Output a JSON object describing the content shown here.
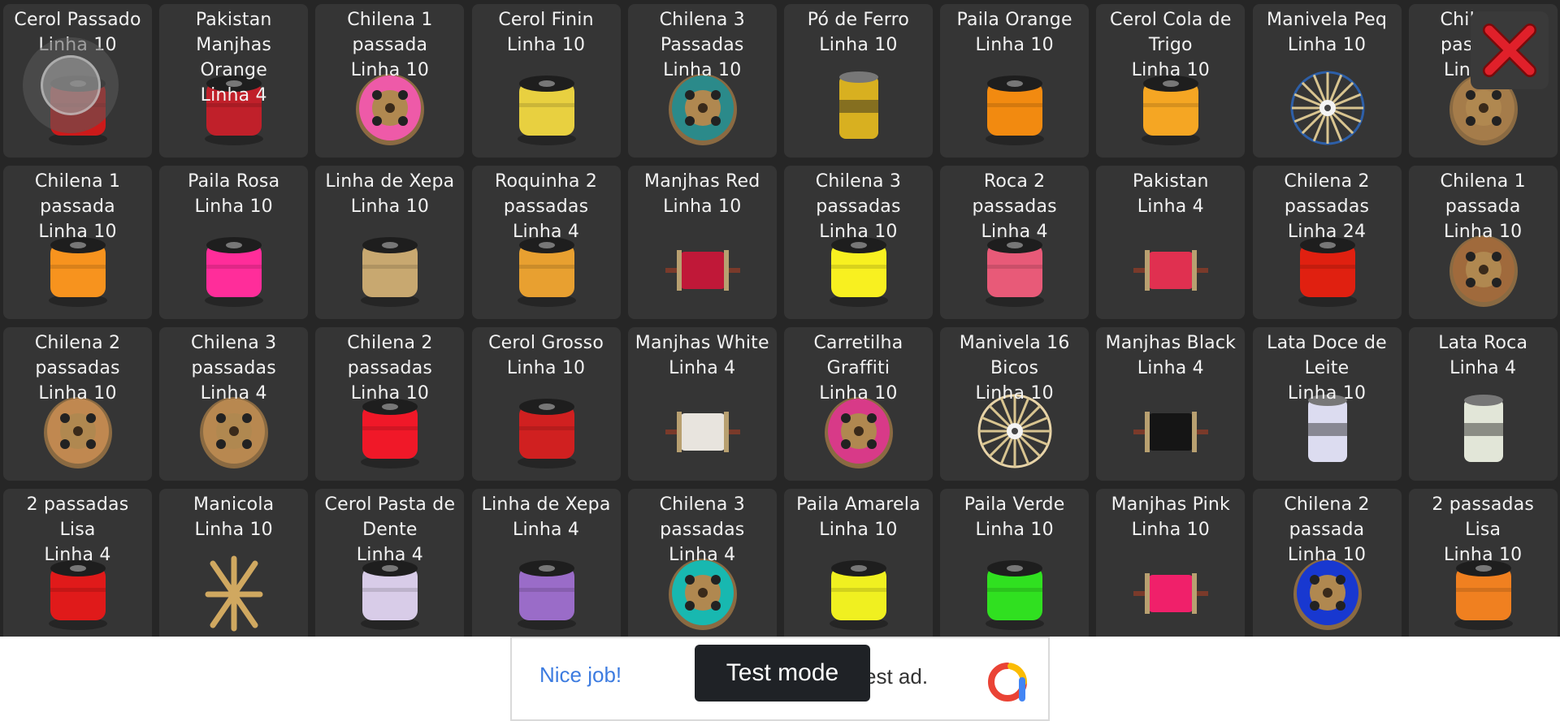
{
  "items": [
    {
      "name": "Cerol Passado\nLinha 10",
      "icon": "spool-icon",
      "color": "#cc1a1a"
    },
    {
      "name": "Pakistan\nManjhas\nOrange\nLinha 4",
      "icon": "spool-icon",
      "color": "#c0202a"
    },
    {
      "name": "Chilena 1\npassada\nLinha 10",
      "icon": "reel-icon",
      "color": "#ee5aa8"
    },
    {
      "name": "Cerol Finin\nLinha 10",
      "icon": "spool-icon",
      "color": "#e8d040"
    },
    {
      "name": "Chilena 3\nPassadas\nLinha 10",
      "icon": "reel-icon",
      "color": "#2b8a8a"
    },
    {
      "name": "Pó de Ferro\nLinha 10",
      "icon": "can-icon",
      "color": "#d8b020"
    },
    {
      "name": "Paila Orange\nLinha 10",
      "icon": "spool-icon",
      "color": "#f28a10"
    },
    {
      "name": "Cerol Cola de\nTrigo\nLinha 10",
      "icon": "spool-icon",
      "color": "#f5a623"
    },
    {
      "name": "Manivela Peq\nLinha 10",
      "icon": "wheel-icon",
      "color": "#2d5fa8"
    },
    {
      "name": "Chilena 4\npassadas\nLinha 10",
      "icon": "reel-icon",
      "color": "#a57c4a"
    },
    {
      "name": "Chilena 1\npassada\nLinha 10",
      "icon": "spool-icon",
      "color": "#f7931e"
    },
    {
      "name": "Paila Rosa\nLinha 10",
      "icon": "spool-icon",
      "color": "#ff2d9a"
    },
    {
      "name": "Linha de Xepa\nLinha 10",
      "icon": "spool-icon",
      "color": "#c8a870"
    },
    {
      "name": "Roquinha 2\npassadas\nLinha 4",
      "icon": "spool-icon",
      "color": "#e8a030"
    },
    {
      "name": "Manjhas Red\nLinha 10",
      "icon": "stick-spool-icon",
      "color": "#c01838"
    },
    {
      "name": "Chilena 3\npassadas\nLinha 10",
      "icon": "spool-icon",
      "color": "#f8f020"
    },
    {
      "name": "Roca 2\npassadas\nLinha 4",
      "icon": "spool-icon",
      "color": "#e85a78"
    },
    {
      "name": "Pakistan\nLinha 4",
      "icon": "stick-spool-icon",
      "color": "#e03050"
    },
    {
      "name": "Chilena 2\npassadas\nLinha 24",
      "icon": "spool-icon",
      "color": "#e02010"
    },
    {
      "name": "Chilena 1\npassada\nLinha 10",
      "icon": "reel-icon",
      "color": "#a06a3c"
    },
    {
      "name": "Chilena 2\npassadas\nLinha 10",
      "icon": "reel-icon",
      "color": "#c08850"
    },
    {
      "name": "Chilena 3\npassadas\nLinha 4",
      "icon": "reel-icon",
      "color": "#b88850"
    },
    {
      "name": "Chilena 2\npassadas\nLinha 10",
      "icon": "spool-icon",
      "color": "#f01828"
    },
    {
      "name": "Cerol Grosso\nLinha 10",
      "icon": "spool-icon",
      "color": "#d02020"
    },
    {
      "name": "Manjhas White\nLinha 4",
      "icon": "stick-spool-icon",
      "color": "#e8e4de"
    },
    {
      "name": "Carretilha\nGraffiti\nLinha 10",
      "icon": "reel-icon",
      "color": "#d83a88"
    },
    {
      "name": "Manivela 16\nBicos\nLinha 10",
      "icon": "wheel-icon",
      "color": "#e8d4a8"
    },
    {
      "name": "Manjhas Black\nLinha 4",
      "icon": "stick-spool-icon",
      "color": "#151515"
    },
    {
      "name": "Lata Doce de\nLeite\nLinha 10",
      "icon": "can-icon",
      "color": "#dcdcf0"
    },
    {
      "name": "Lata Roca\nLinha 4",
      "icon": "can-icon",
      "color": "#e2e6d8"
    },
    {
      "name": "2 passadas\nLisa\nLinha 4",
      "icon": "spool-icon",
      "color": "#e01a1a"
    },
    {
      "name": "Manicola\nLinha 10",
      "icon": "frame-icon",
      "color": "#d0a860"
    },
    {
      "name": "Cerol Pasta de\nDente\nLinha 4",
      "icon": "spool-icon",
      "color": "#d8cce8"
    },
    {
      "name": "Linha de Xepa\nLinha 4",
      "icon": "spool-icon",
      "color": "#9a6cc8"
    },
    {
      "name": "Chilena 3\npassadas\nLinha 4",
      "icon": "reel-icon",
      "color": "#18b8b0"
    },
    {
      "name": "Paila Amarela\nLinha 10",
      "icon": "spool-icon",
      "color": "#f0f020"
    },
    {
      "name": "Paila Verde\nLinha 10",
      "icon": "spool-icon",
      "color": "#30e020"
    },
    {
      "name": "Manjhas Pink\nLinha 10",
      "icon": "stick-spool-icon",
      "color": "#f0206a"
    },
    {
      "name": "Chilena 2\npassada\nLinha 10",
      "icon": "reel-icon",
      "color": "#1838d0"
    },
    {
      "name": "2 passadas\nLisa\nLinha 10",
      "icon": "spool-icon",
      "color": "#f08020"
    }
  ],
  "close_icon": "close-icon",
  "ad": {
    "nice_job": "Nice job!",
    "test_mode": "Test mode",
    "rest": "est ad.",
    "logo_icon": "admob-logo-icon"
  },
  "colors": {
    "background": "#262626",
    "card": "#353535",
    "close_red": "#e0202a",
    "ad_blue": "#3d7ce0"
  }
}
